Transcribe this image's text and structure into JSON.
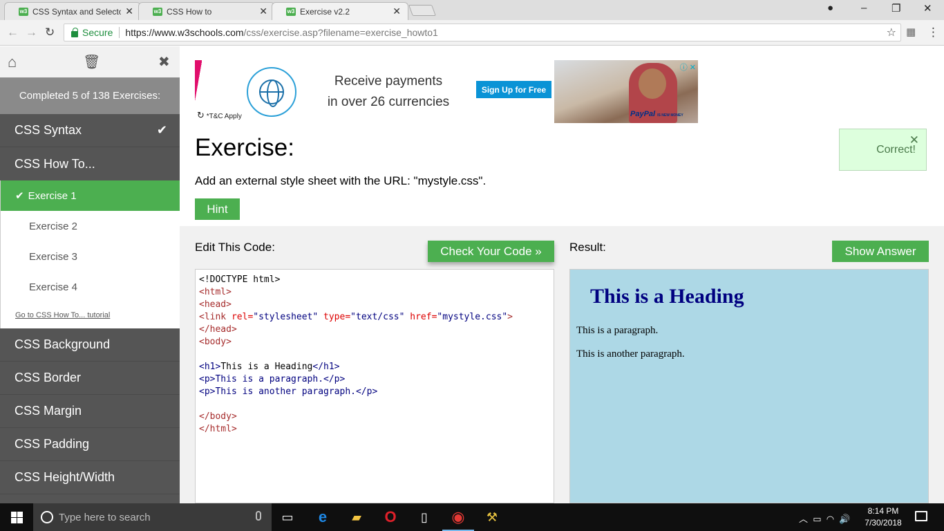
{
  "browser": {
    "tabs": [
      {
        "label": "CSS Syntax and Selectors",
        "favicon": "w3"
      },
      {
        "label": "CSS How to",
        "favicon": "w3"
      },
      {
        "label": "Exercise v2.2",
        "favicon": "w3",
        "active": true
      }
    ],
    "secure_label": "Secure",
    "url_host": "https://www.w3schools.com",
    "url_path": "/css/exercise.asp?filename=exercise_howto1"
  },
  "sidebar": {
    "progress_text": "Completed 5 of 138 Exercises:",
    "topics_before": [
      {
        "label": "CSS Syntax",
        "completed": true
      },
      {
        "label": "CSS How To...",
        "completed": false
      }
    ],
    "exercises": [
      {
        "label": "Exercise 1",
        "current": true
      },
      {
        "label": "Exercise 2"
      },
      {
        "label": "Exercise 3"
      },
      {
        "label": "Exercise 4"
      }
    ],
    "tutorial_link": "Go to CSS How To... tutorial",
    "topics_after": [
      {
        "label": "CSS Background"
      },
      {
        "label": "CSS Border"
      },
      {
        "label": "CSS Margin"
      },
      {
        "label": "CSS Padding"
      },
      {
        "label": "CSS Height/Width"
      }
    ]
  },
  "ad": {
    "headline_1": "Receive payments",
    "headline_2": "in over 26 currencies",
    "button": "Sign Up for Free",
    "terms": "*T&C Apply",
    "brand": "PayPal",
    "brand_tagline": "IS NEW MONEY"
  },
  "exercise": {
    "title": "Exercise:",
    "description": "Add an external style sheet with the URL: \"mystyle.css\".",
    "hint_label": "Hint",
    "correct_text": "Correct!",
    "edit_label": "Edit This Code:",
    "check_label": "Check Your Code »",
    "result_label": "Result:",
    "answer_label": "Show Answer"
  },
  "code": {
    "doctype": "<!DOCTYPE html>",
    "html_open": "<html>",
    "head_open": "<head>",
    "link_open": "<link",
    "rel_attr": "rel=",
    "rel_val": "\"stylesheet\"",
    "type_attr": "type=",
    "type_val": "\"text/css\"",
    "href_attr": "href=",
    "href_val": "\"mystyle.css\"",
    "link_close": ">",
    "head_close": "</head>",
    "body_open": "<body>",
    "h1_open": "<h1>",
    "h1_text": "This is a Heading",
    "h1_close": "</h1>",
    "p_open": "<p>",
    "p1_text": "This is a paragraph.",
    "p_close": "</p>",
    "p2_text": "This is another paragraph.",
    "body_close": "</body>",
    "html_close": "</html>"
  },
  "result": {
    "heading": "This is a Heading",
    "para_1": "This is a paragraph.",
    "para_2": "This is another paragraph.",
    "background": "#add8e6",
    "heading_color": "#000080"
  },
  "taskbar": {
    "search_placeholder": "Type here to search",
    "time": "8:14 PM",
    "date": "7/30/2018"
  },
  "colors": {
    "accent_green": "#4caf50",
    "sidebar_dark": "#555555",
    "correct_bg": "#ddffdd"
  }
}
